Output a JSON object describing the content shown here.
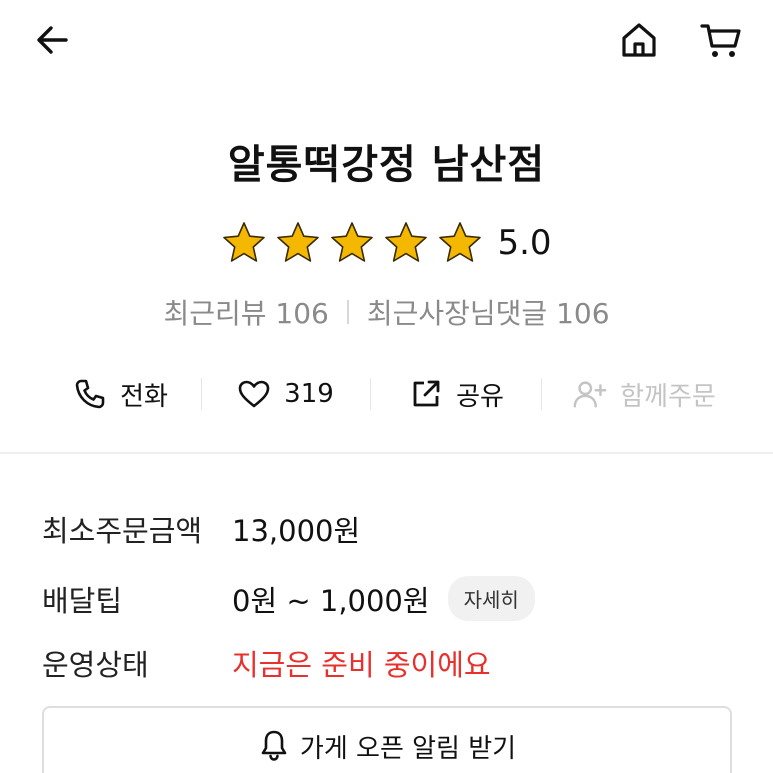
{
  "header": {
    "back_icon": "arrow-left-icon",
    "home_icon": "home-icon",
    "cart_icon": "cart-icon"
  },
  "store": {
    "name": "알통떡강정 남산점",
    "rating": "5.0",
    "stars_filled": 5,
    "star_color": "#f5b800"
  },
  "reviews": {
    "recent_reviews": "최근리뷰 106",
    "owner_replies": "최근사장님댓글 106"
  },
  "actions": {
    "call_label": "전화",
    "like_count": "319",
    "share_label": "공유",
    "group_order_label": "함께주문"
  },
  "info": {
    "min_order_label": "최소주문금액",
    "min_order_value": "13,000원",
    "delivery_tip_label": "배달팁",
    "delivery_tip_value": "0원 ~ 1,000원",
    "detail_label": "자세히",
    "status_label": "운영상태",
    "status_value": "지금은 준비 중이에요",
    "status_color": "#e8302c"
  },
  "notify": {
    "label": "가게 오픈 알림 받기"
  }
}
